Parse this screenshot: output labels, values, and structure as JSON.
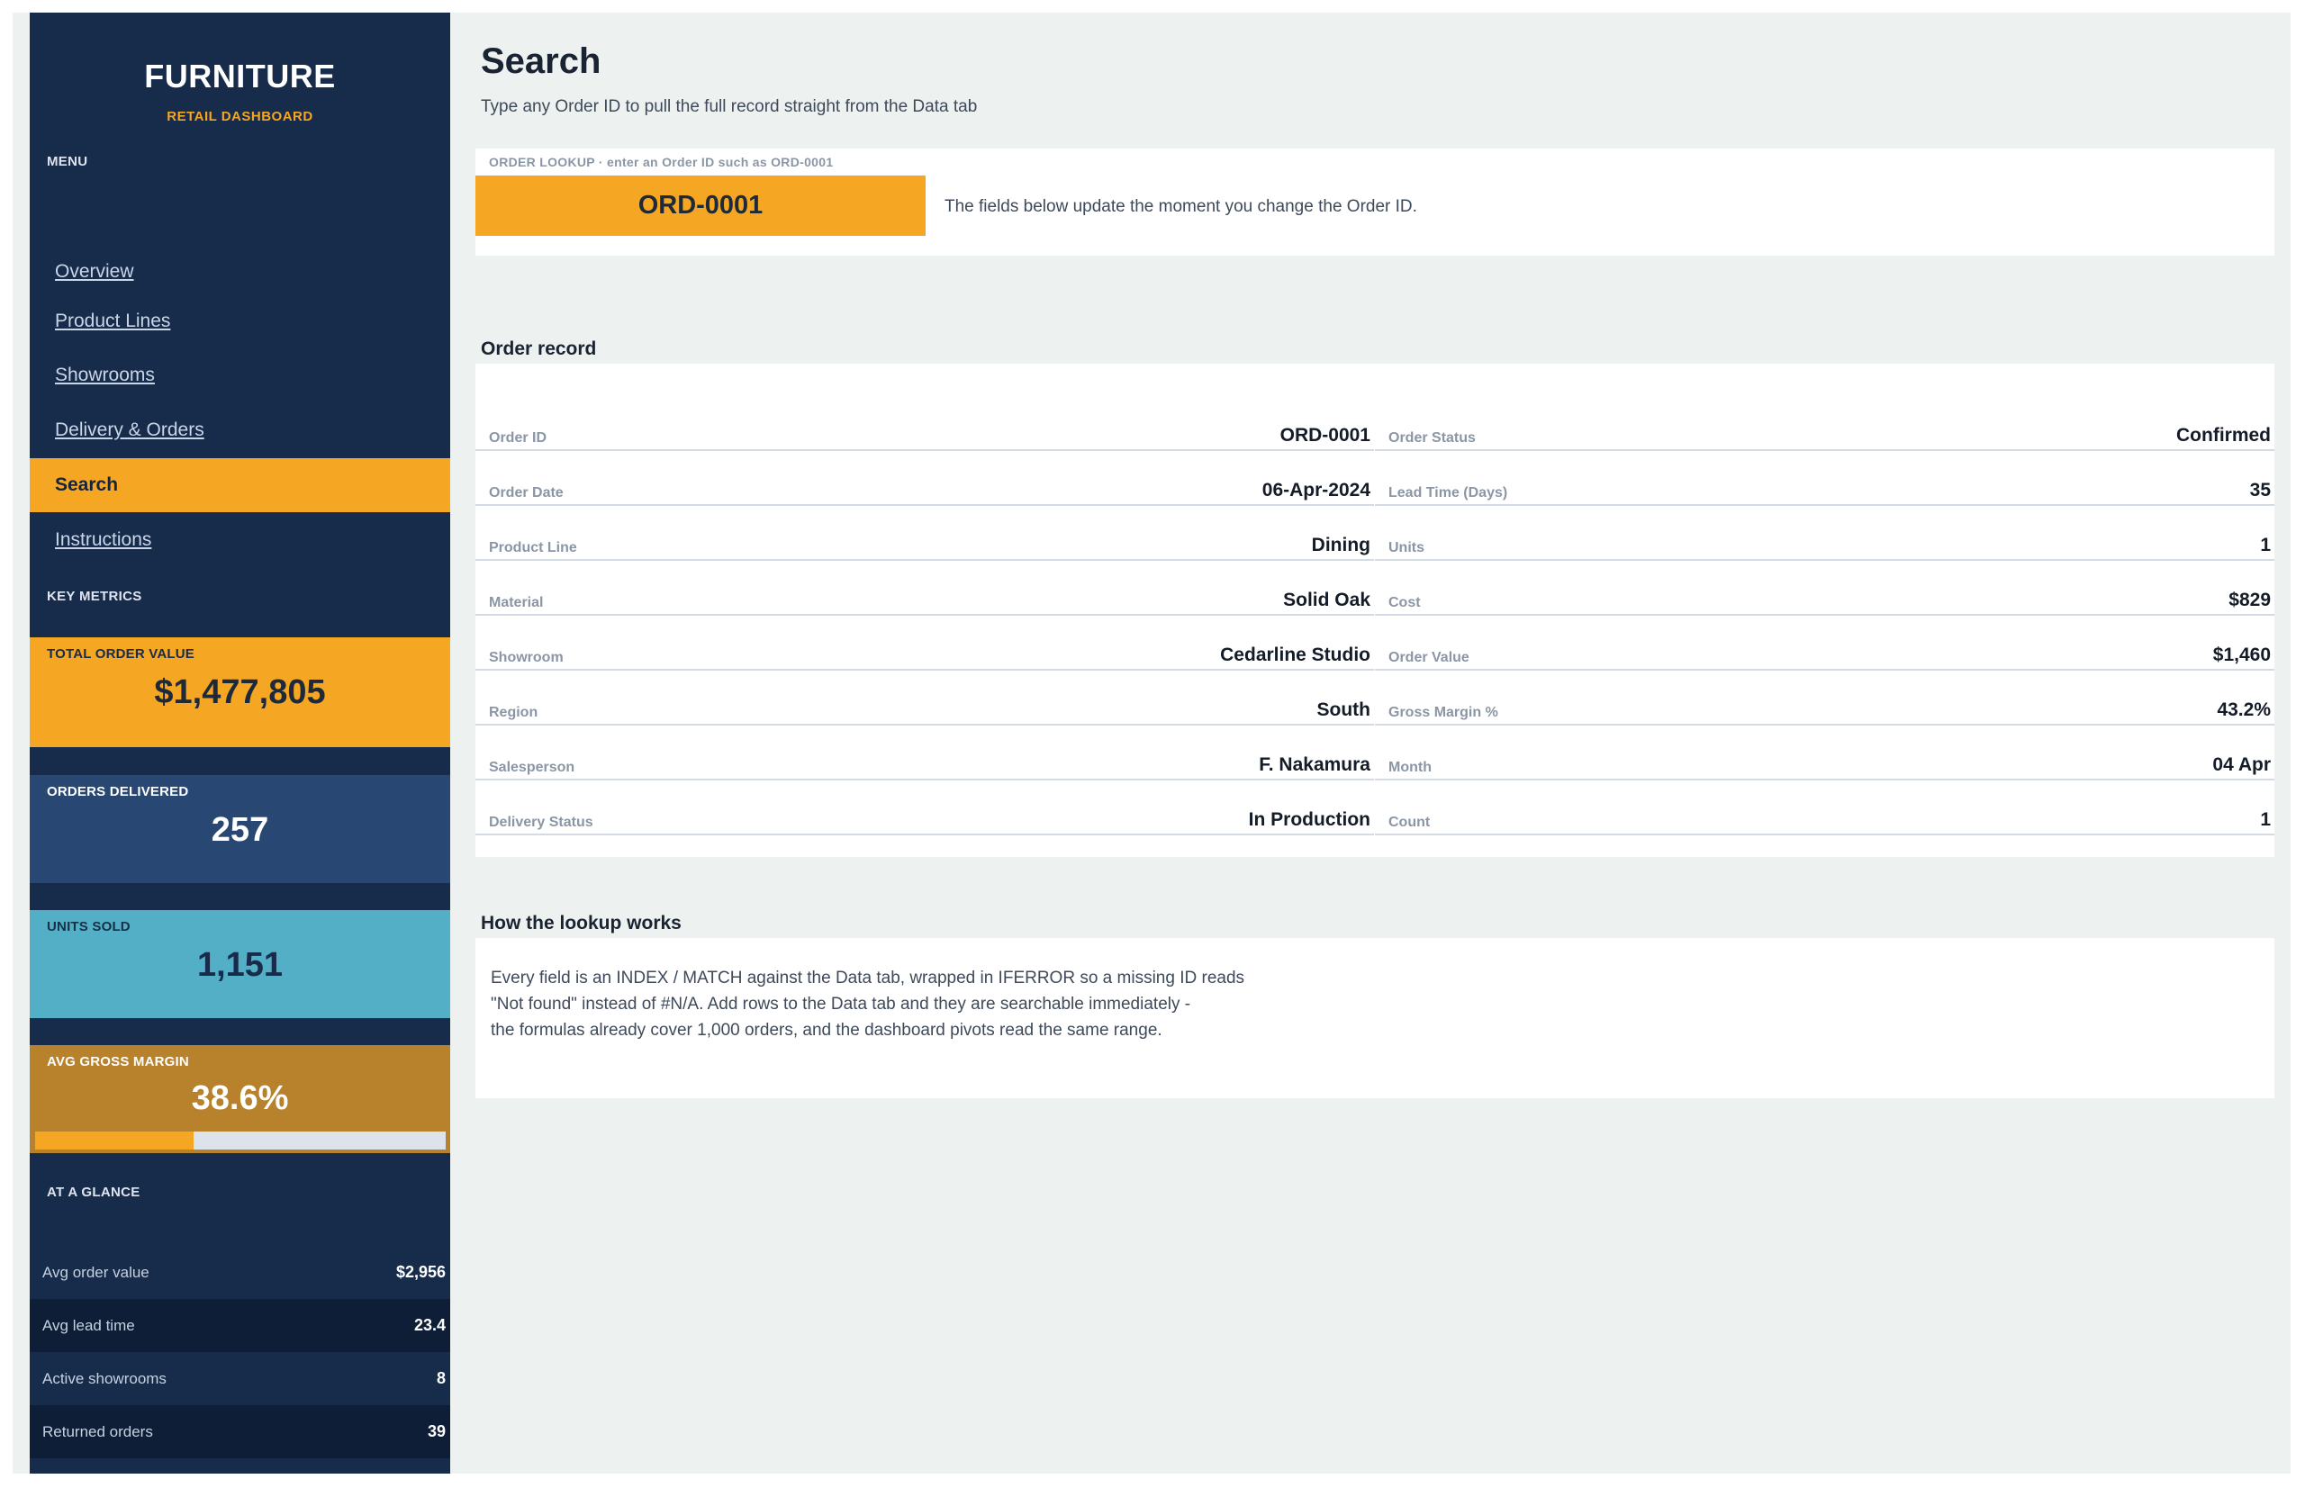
{
  "sidebar": {
    "brand_title": "FURNITURE",
    "brand_subtitle": "RETAIL DASHBOARD",
    "menu_label": "MENU",
    "nav": [
      {
        "label": "Overview",
        "active": false
      },
      {
        "label": "Product Lines",
        "active": false
      },
      {
        "label": "Showrooms",
        "active": false
      },
      {
        "label": "Delivery & Orders",
        "active": false
      },
      {
        "label": "Search",
        "active": true
      },
      {
        "label": "Instructions",
        "active": false
      }
    ],
    "key_metrics_label": "KEY METRICS",
    "metrics": {
      "total_order_value": {
        "label": "TOTAL ORDER VALUE",
        "value": "$1,477,805"
      },
      "orders_delivered": {
        "label": "ORDERS DELIVERED",
        "value": "257"
      },
      "units_sold": {
        "label": "UNITS SOLD",
        "value": "1,151"
      },
      "avg_gross_margin": {
        "label": "AVG GROSS MARGIN",
        "value": "38.6%",
        "progress_fraction": 0.386
      }
    },
    "at_a_glance_label": "AT A GLANCE",
    "glance": [
      {
        "label": "Avg order value",
        "value": "$2,956"
      },
      {
        "label": "Avg lead time",
        "value": "23.4"
      },
      {
        "label": "Active showrooms",
        "value": "8"
      },
      {
        "label": "Returned orders",
        "value": "39"
      }
    ]
  },
  "main": {
    "title": "Search",
    "subtitle": "Type any Order ID to pull the full record straight from the Data tab",
    "lookup": {
      "label": "ORDER LOOKUP  ·  enter an Order ID such as ORD-0001",
      "value": "ORD-0001",
      "note": "The fields below update the moment you change the Order ID."
    },
    "record_heading": "Order record",
    "record": {
      "left": [
        {
          "label": "Order ID",
          "value": "ORD-0001"
        },
        {
          "label": "Order Date",
          "value": "06-Apr-2024"
        },
        {
          "label": "Product Line",
          "value": "Dining"
        },
        {
          "label": "Material",
          "value": "Solid Oak"
        },
        {
          "label": "Showroom",
          "value": "Cedarline Studio"
        },
        {
          "label": "Region",
          "value": "South"
        },
        {
          "label": "Salesperson",
          "value": "F. Nakamura"
        },
        {
          "label": "Delivery Status",
          "value": "In Production"
        }
      ],
      "right": [
        {
          "label": "Order Status",
          "value": "Confirmed"
        },
        {
          "label": "Lead Time (Days)",
          "value": "35"
        },
        {
          "label": "Units",
          "value": "1"
        },
        {
          "label": "Cost",
          "value": "$829"
        },
        {
          "label": "Order Value",
          "value": "$1,460"
        },
        {
          "label": "Gross Margin %",
          "value": "43.2%"
        },
        {
          "label": "Month",
          "value": "04 Apr"
        },
        {
          "label": "Count",
          "value": "1"
        }
      ]
    },
    "how_heading": "How the lookup works",
    "how_lines": [
      "Every field is an INDEX / MATCH against the Data tab, wrapped in IFERROR so a missing ID reads",
      "\"Not found\" instead of #N/A. Add rows to the Data tab and they are searchable immediately -",
      "the formulas already cover 1,000 orders, and the dashboard pivots read the same range."
    ]
  },
  "colors": {
    "sidebar_bg": "#172b4a",
    "accent_orange": "#f5a623",
    "delivered_bg": "#284873",
    "units_bg": "#52afc6",
    "margin_bg": "#b7822b",
    "page_bg": "#edf1f0"
  }
}
